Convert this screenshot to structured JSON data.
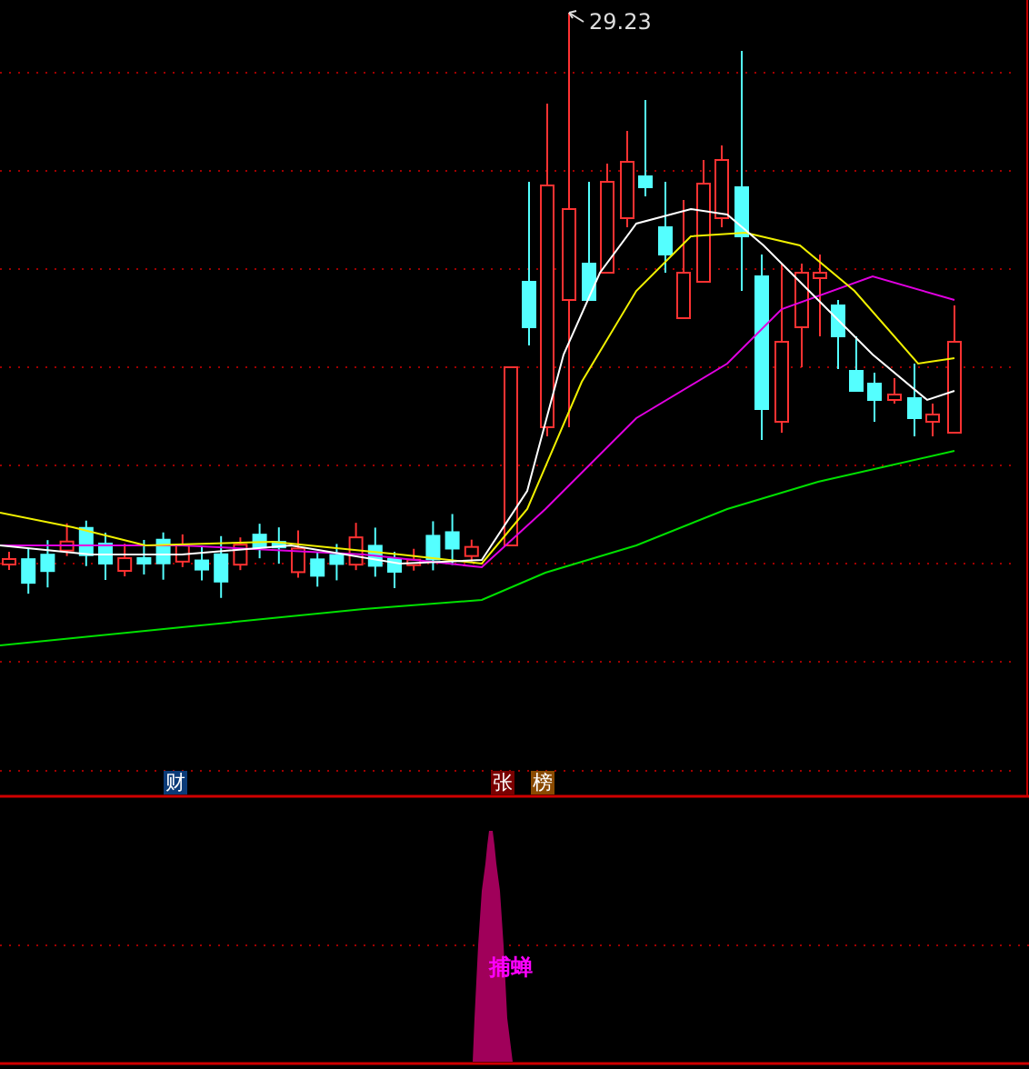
{
  "price_chart": {
    "peak_label": "29.23"
  },
  "markers": [
    {
      "text": "财",
      "color": "#0b3b78"
    },
    {
      "text": "张",
      "color": "#7a0000"
    },
    {
      "text": "榜",
      "color": "#8a4a00"
    }
  ],
  "indicator": {
    "label": "捕蝉"
  }
}
